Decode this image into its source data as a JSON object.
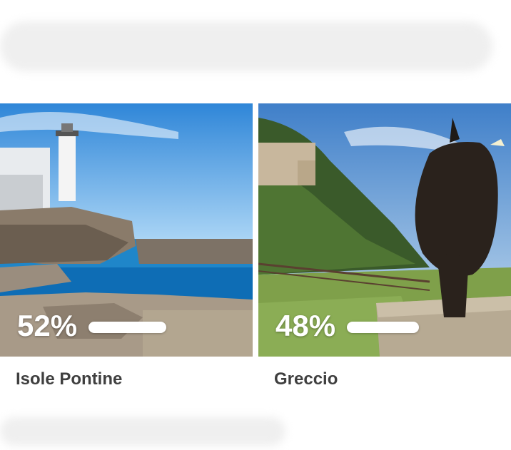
{
  "poll": {
    "options": [
      {
        "name": "Isole Pontine",
        "percent_label": "52%",
        "percent": 52
      },
      {
        "name": "Greccio",
        "percent_label": "48%",
        "percent": 48
      }
    ]
  },
  "colors": {
    "text": "#3f3f3f",
    "bar": "#ffffff",
    "sea": "#1e7fc4",
    "sky": "#4a9fe3"
  }
}
